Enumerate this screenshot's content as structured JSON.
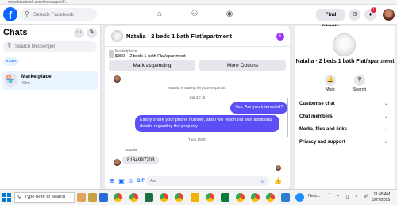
{
  "browser": {
    "url": "www.facebook.com/messages/t/..."
  },
  "topnav": {
    "logo": "f",
    "search_placeholder": "Search Facebook",
    "find_friends": "Find friends",
    "notification_count": "1"
  },
  "left": {
    "title": "Chats",
    "search_placeholder": "Search Messenger",
    "inbox": "Inbox",
    "chats": [
      {
        "name": "Marketplace",
        "time": "42m"
      }
    ]
  },
  "conversation": {
    "title": "Natalia · 2 beds 1 bath Flat/apartment",
    "marketplace": {
      "label": "Marketplace",
      "listing": "$850 – 2 beds 1 bath Flat/apartment",
      "mark_pending": "Mark as pending",
      "more_options": "More Options"
    },
    "waiting_text": "Natalia is waiting for your response.",
    "date1": "Sat 22:15",
    "out_msg1": "Yes. Are you interested?",
    "out_msg2": "Kindly share your phone number, and I will reach out with additional details regarding the property",
    "date2": "Tues 19:00",
    "sender": "Natalia",
    "in_msg": "8134997703",
    "composer_placeholder": "Aa"
  },
  "info_panel": {
    "title": "Natalia · 2 beds 1 bath Flat/apartment",
    "mute": "Mute",
    "search": "Search",
    "rows": [
      "Customise chat",
      "Chat members",
      "Media, files and links",
      "Privacy and support"
    ]
  },
  "taskbar": {
    "search_text": "Type here to search",
    "weather": "New...",
    "time": "11:45 AM",
    "date": "3/27/2025"
  },
  "colors": {
    "brand": "#0866ff",
    "outgoing_bubble": "#5b4ff5",
    "badge": "#e41e3f",
    "info_button": "#a033ff"
  }
}
